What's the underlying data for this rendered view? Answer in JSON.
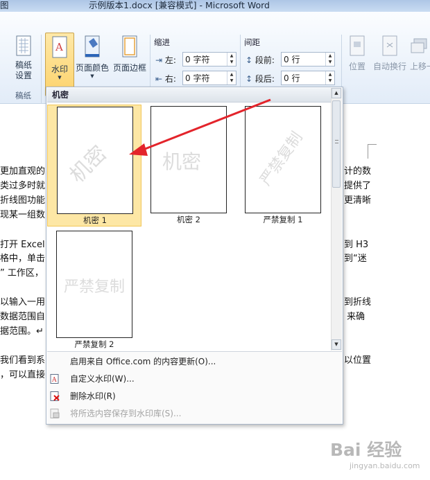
{
  "window": {
    "title_left": "图",
    "title": "示例版本1.docx [兼容模式] - Microsoft Word"
  },
  "ribbon": {
    "manuscript": {
      "label": "稿纸\n设置",
      "group": "稿纸"
    },
    "watermark": {
      "label": "水印"
    },
    "page_color": {
      "label": "页面颜色"
    },
    "page_border": {
      "label": "页面边框"
    },
    "indent": {
      "group": "缩进",
      "left_label": "左:",
      "left_value": "0 字符",
      "right_label": "右:",
      "right_value": "0 字符"
    },
    "spacing": {
      "group": "间距",
      "before_label": "段前:",
      "before_value": "0 行",
      "after_label": "段后:",
      "after_value": "0 行"
    },
    "position": {
      "label": "位置"
    },
    "wrap": {
      "label": "自动换行"
    },
    "bring_forward": {
      "label": "上移一"
    }
  },
  "gallery": {
    "header": "机密",
    "items": [
      {
        "caption": "机密 1",
        "watermark": "机密",
        "style": "diagonal",
        "selected": true
      },
      {
        "caption": "机密 2",
        "watermark": "机密",
        "style": "horizontal",
        "selected": false
      },
      {
        "caption": "严禁复制 1",
        "watermark": "严禁复制",
        "style": "diagonal",
        "selected": false
      },
      {
        "caption": "严禁复制 2",
        "watermark": "严禁复制",
        "style": "horizontal",
        "selected": false
      }
    ],
    "menu": [
      {
        "label": "启用来自 Office.com 的内容更新(O)...",
        "icon": "none",
        "disabled": false
      },
      {
        "label": "自定义水印(W)...",
        "icon": "custom-watermark-icon",
        "disabled": false
      },
      {
        "label": "删除水印(R)",
        "icon": "remove-watermark-icon",
        "disabled": false
      },
      {
        "label": "将所选内容保存到水印库(S)...",
        "icon": "save-gallery-icon",
        "disabled": true
      }
    ]
  },
  "document": {
    "left_lines": [
      "更加直观的",
      "类过多时就",
      "折线图功能",
      "现某一组数",
      "打开 Excel",
      "格中，单击",
      "” 工作区，",
      "以输入一用",
      "数据范围自",
      "据范围。↵",
      "我们看到系",
      "，可以直接"
    ],
    "right_lines": [
      "计的数",
      "提供了",
      "更清晰",
      "到 H3",
      "到“迷",
      "到折线",
      "来确",
      "以位置"
    ]
  },
  "brand": {
    "text": "Bai 经验",
    "url": "jingyan.baidu.com"
  },
  "colors": {
    "accent": "#f2c658",
    "arrow": "#e3242b",
    "watermark": "#dcdcdc"
  }
}
